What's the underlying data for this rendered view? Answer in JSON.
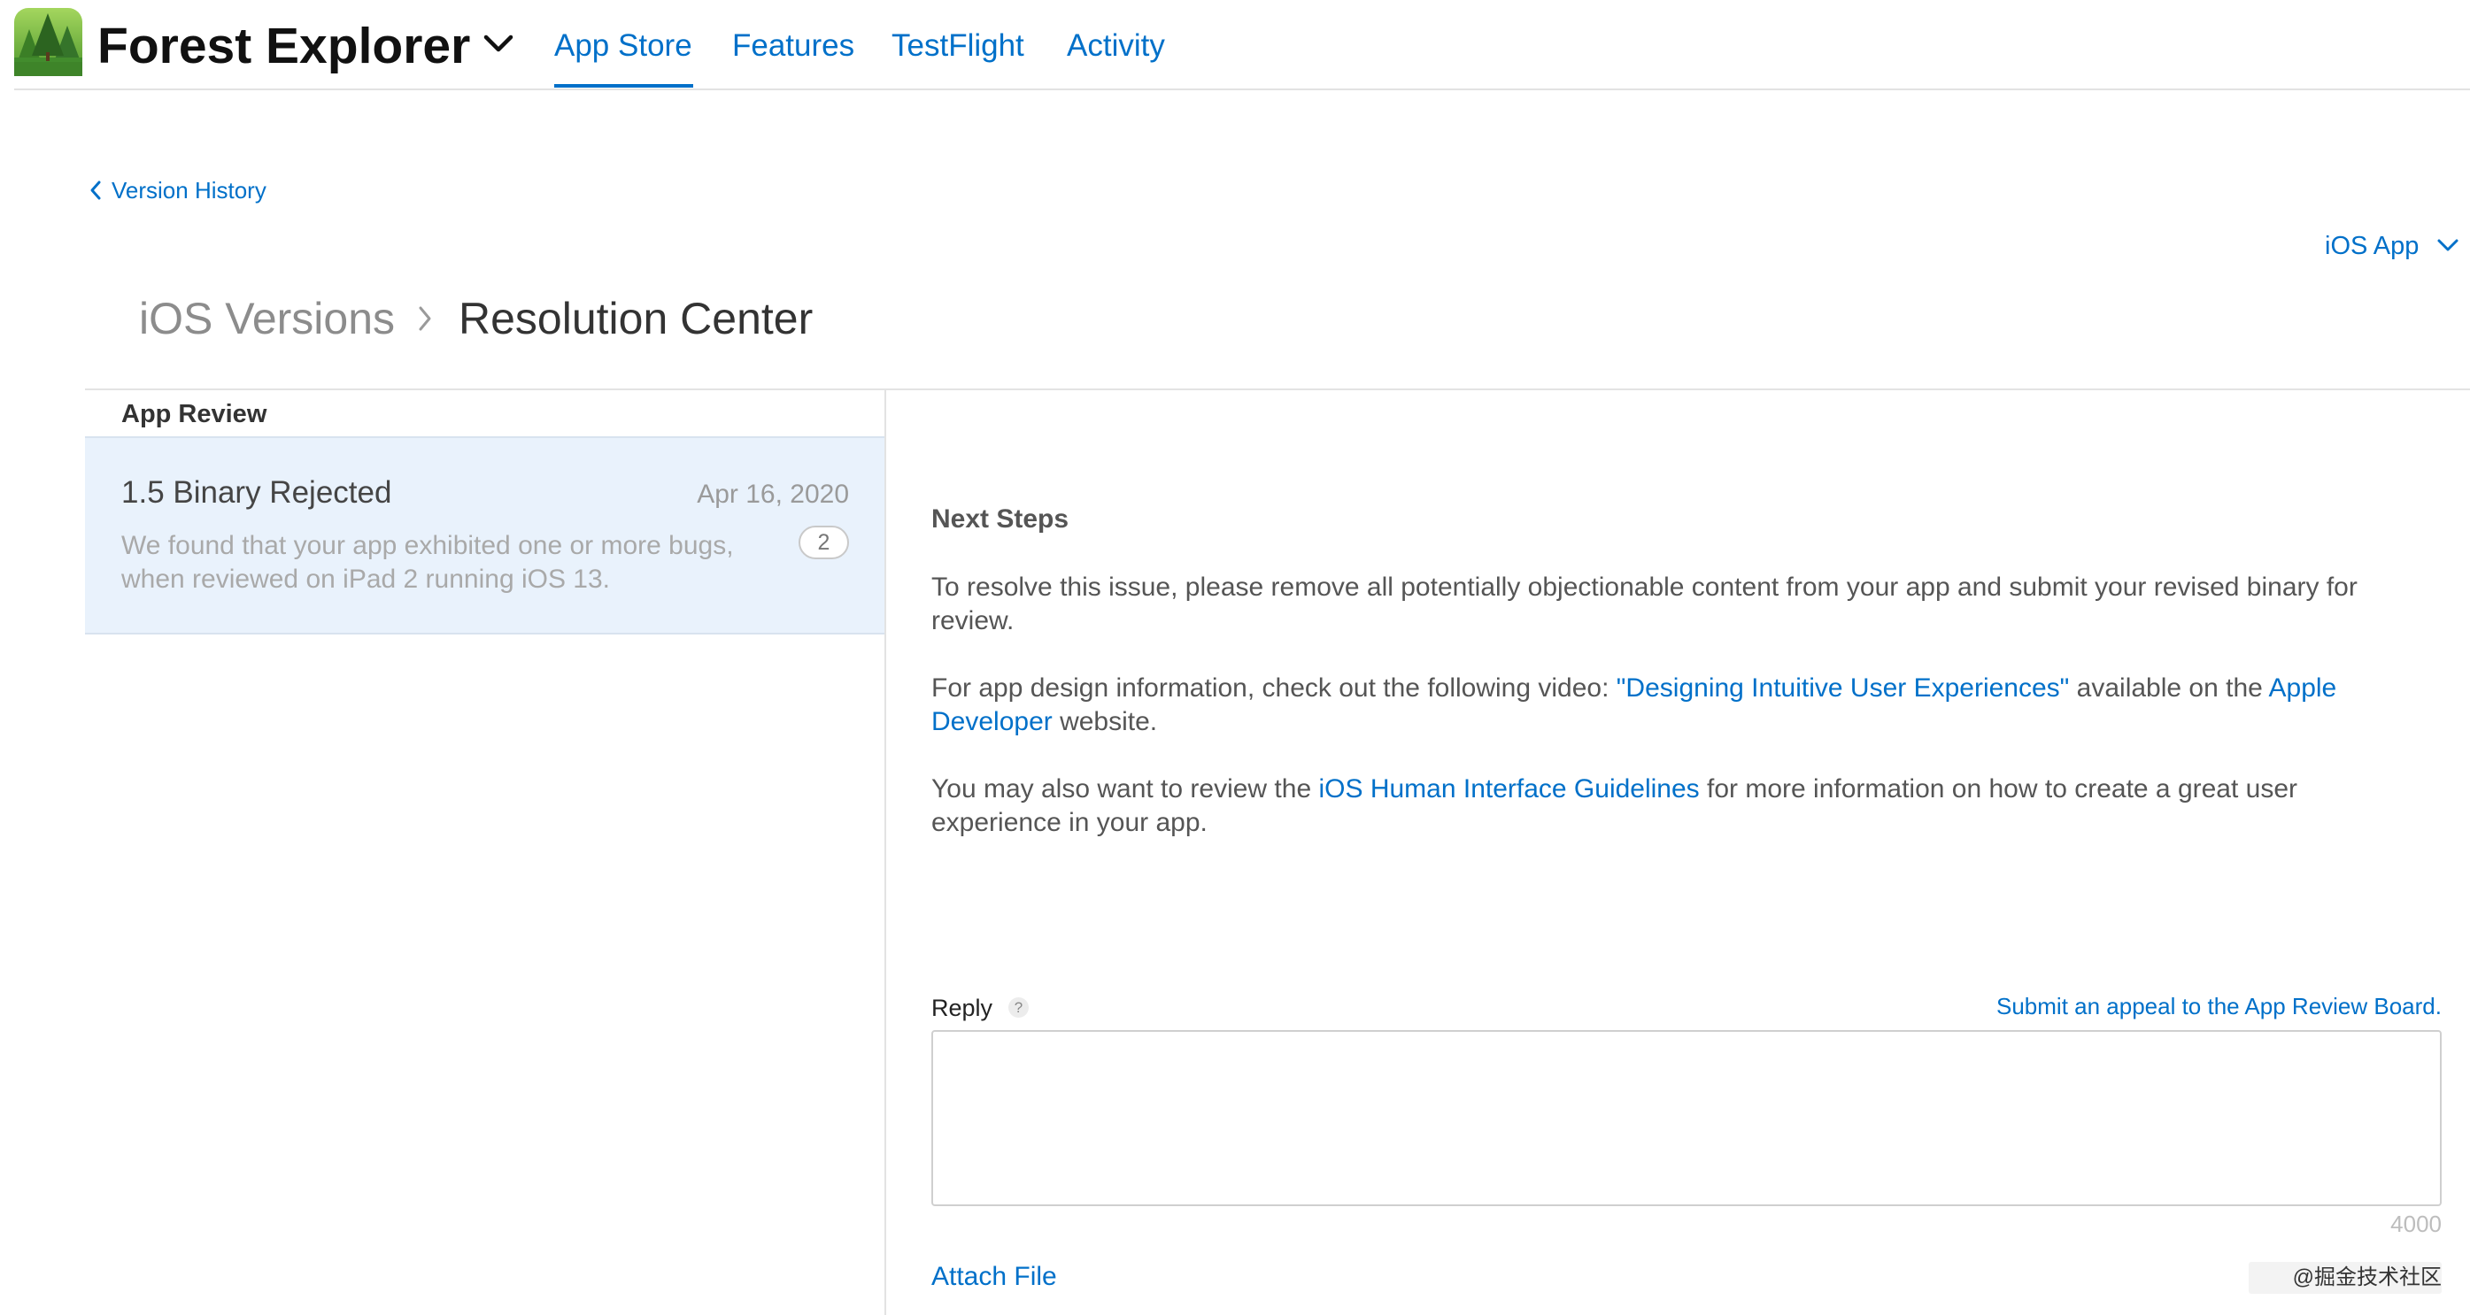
{
  "app": {
    "name": "Forest Explorer"
  },
  "nav": {
    "tabs": [
      {
        "label": "App Store",
        "active": true
      },
      {
        "label": "Features",
        "active": false
      },
      {
        "label": "TestFlight",
        "active": false
      },
      {
        "label": "Activity",
        "active": false
      }
    ]
  },
  "back_link": {
    "label": "Version History"
  },
  "platform_select": {
    "label": "iOS App"
  },
  "breadcrumb": {
    "parent": "iOS Versions",
    "current": "Resolution Center"
  },
  "sidebar": {
    "heading": "App Review",
    "items": [
      {
        "title": "1.5 Binary Rejected",
        "date": "Apr 16, 2020",
        "summary": "We found that your app exhibited one or more bugs, when reviewed on iPad 2 running iOS 13.",
        "message_count": "2",
        "selected": true
      }
    ]
  },
  "detail": {
    "heading": "Next Steps",
    "p1": "To resolve this issue, please remove all potentially objectionable content from your app and submit your revised binary for review.",
    "p2": {
      "before": "For app design information, check out the following video: ",
      "video_link": "\"Designing Intuitive User Experiences\"",
      "middle": " available on the ",
      "developer_link": "Apple Developer",
      "after": " website."
    },
    "p3": {
      "before": "You may also want to review the ",
      "hig_link": "iOS Human Interface Guidelines",
      "after": " for more information on how to create a great user experience in your app."
    }
  },
  "reply": {
    "label": "Reply",
    "help": "?",
    "appeal_link": "Submit an appeal to the App Review Board.",
    "char_limit": "4000",
    "attach_label": "Attach File"
  },
  "watermark": "@掘金技术社区",
  "icons": {
    "app": "forest-app-icon",
    "app_switch": "chevron-down-icon",
    "back": "chevron-left-icon",
    "breadcrumb_separator": "chevron-right-icon",
    "platform": "chevron-down-icon",
    "help": "help-icon"
  },
  "colors": {
    "accent": "#0070c9",
    "selected_background": "#e9f2fc",
    "text": "#555555"
  }
}
